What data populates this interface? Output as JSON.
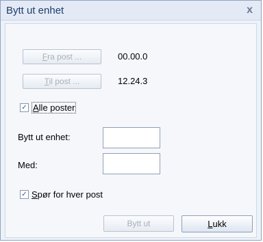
{
  "dialog": {
    "title": "Bytt ut enhet",
    "close_label": "x"
  },
  "range": {
    "from_button": {
      "prefix": "",
      "accel": "F",
      "rest": "ra post ..."
    },
    "from_value": "00.00.0",
    "to_button": {
      "prefix": "",
      "accel": "T",
      "rest": "il post ..."
    },
    "to_value": "12.24.3",
    "all_posts": {
      "checked": true,
      "accel": "A",
      "rest": "lle poster"
    }
  },
  "fields": {
    "replace_label": "Bytt ut enhet:",
    "with_label": "Med:",
    "replace_value": "",
    "with_value": ""
  },
  "ask_each": {
    "checked": true,
    "accel": "S",
    "rest": "pør for hver post"
  },
  "buttons": {
    "replace": "Bytt ut",
    "close": {
      "accel": "L",
      "rest": "ukk"
    }
  },
  "icons": {
    "check": "✓"
  }
}
